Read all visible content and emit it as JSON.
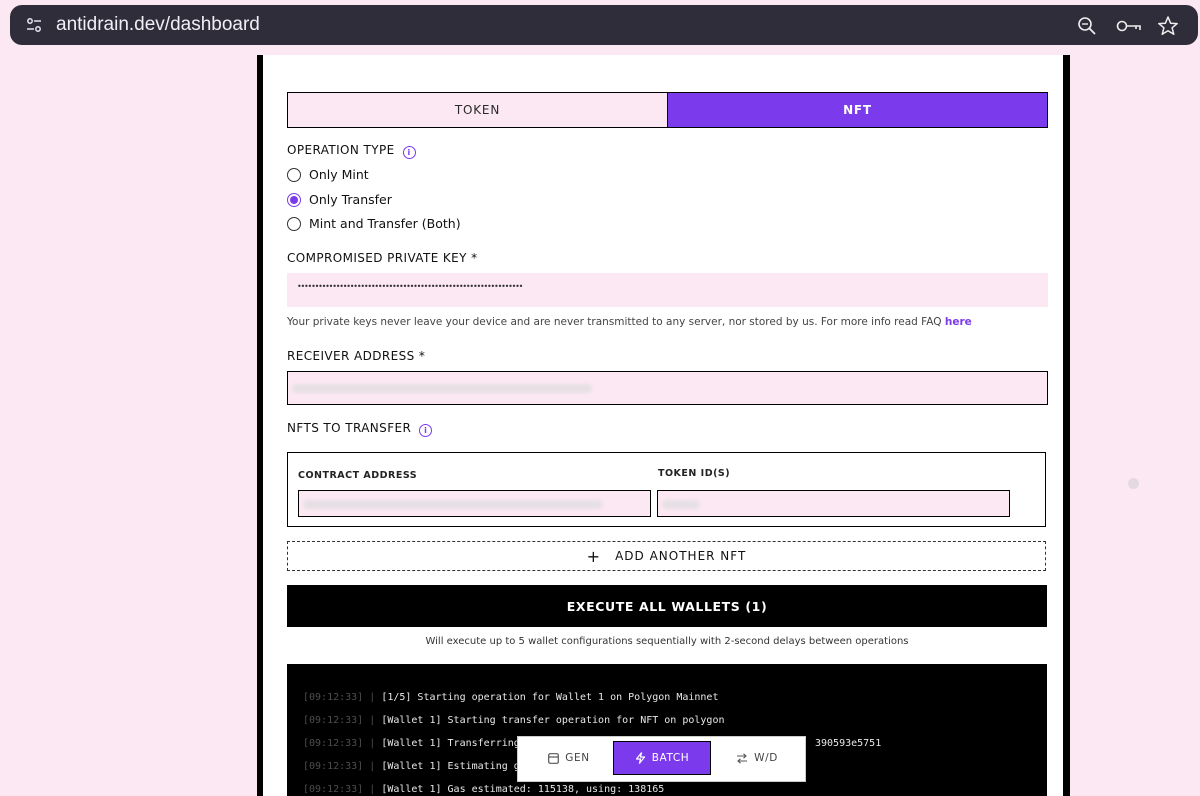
{
  "browser": {
    "url": "antidrain.dev/dashboard",
    "icons": [
      "site-settings-icon",
      "zoom-icon",
      "key-icon",
      "star-icon"
    ]
  },
  "tabs": {
    "token": "TOKEN",
    "nft": "NFT",
    "active": "NFT"
  },
  "operation": {
    "label": "OPERATION TYPE",
    "options": [
      "Only Mint",
      "Only Transfer",
      "Mint and Transfer (Both)"
    ],
    "selected": "Only Transfer"
  },
  "private_key": {
    "label": "COMPROMISED PRIVATE KEY *",
    "masked_value": "••••••••••••••••••••••••••••••••••••••••••••••••••••••••••••••••",
    "note": "Your private keys never leave your device and are never transmitted to any server, nor stored by us. For more info read FAQ ",
    "note_link": "here"
  },
  "receiver": {
    "label": "RECEIVER ADDRESS *"
  },
  "nfts": {
    "label": "NFTS TO TRANSFER",
    "contract_header": "CONTRACT ADDRESS",
    "token_header": "TOKEN ID(S)"
  },
  "add_nft": {
    "plus": "+",
    "label": "ADD ANOTHER NFT"
  },
  "execute": {
    "label": "EXECUTE ALL WALLETS (1)",
    "note": "Will execute up to 5 wallet configurations sequentially with 2-second delays between operations"
  },
  "console": {
    "lines": [
      {
        "ts": "[09:12:33]",
        "msg": "[1/5] Starting operation for Wallet 1 on Polygon Mainnet"
      },
      {
        "ts": "[09:12:33]",
        "msg": "[Wallet 1] Starting transfer operation for NFT on polygon"
      },
      {
        "ts": "[09:12:33]",
        "msg": "[Wallet 1] Transferring N",
        "tail": "390593e5751"
      },
      {
        "ts": "[09:12:33]",
        "msg": "[Wallet 1] Estimating gas"
      },
      {
        "ts": "[09:12:33]",
        "msg": "[Wallet 1] Gas estimated: 115138, using: 138165"
      }
    ]
  },
  "float_nav": {
    "gen": "GEN",
    "batch": "BATCH",
    "wd": "W/D",
    "active": "BATCH"
  },
  "colors": {
    "accent": "#7c3aed",
    "page_bg": "#fce8f2",
    "field_bg": "#fce8f2"
  }
}
